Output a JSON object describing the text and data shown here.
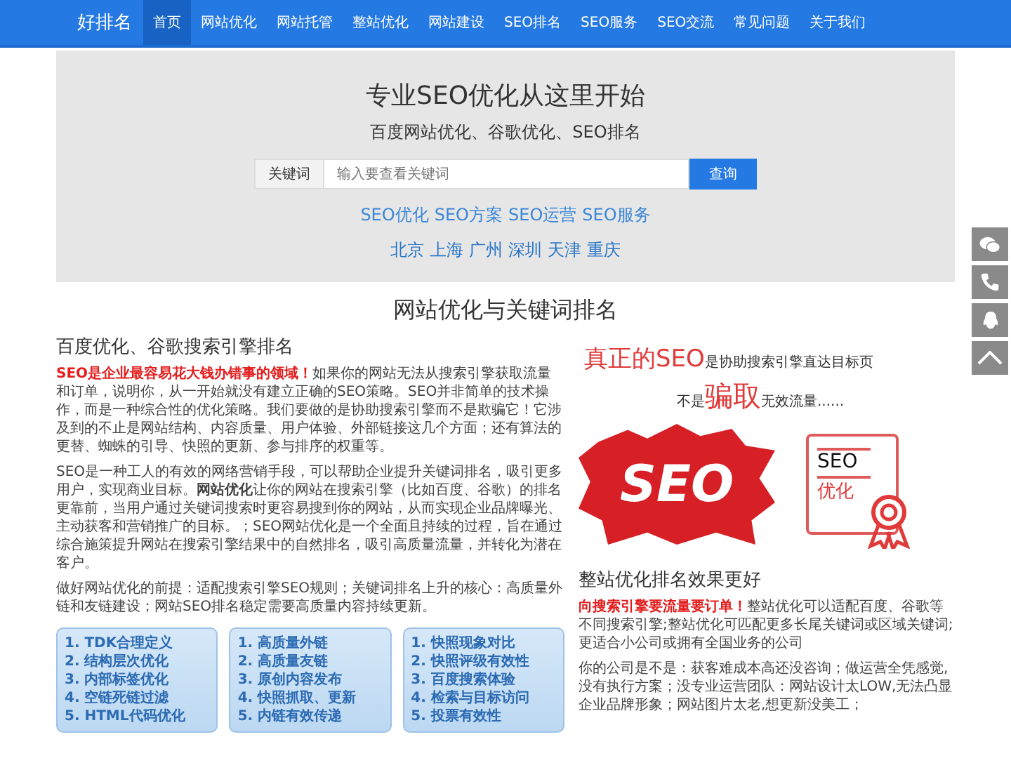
{
  "nav": {
    "brand": "好排名",
    "items": [
      {
        "label": "首页",
        "selected": true
      },
      {
        "label": "网站优化",
        "selected": false
      },
      {
        "label": "网站托管",
        "selected": false
      },
      {
        "label": "整站优化",
        "selected": false
      },
      {
        "label": "网站建设",
        "selected": false
      },
      {
        "label": "SEO排名",
        "selected": false
      },
      {
        "label": "SEO服务",
        "selected": false
      },
      {
        "label": "SEO交流",
        "selected": false
      },
      {
        "label": "常见问题",
        "selected": false
      },
      {
        "label": "关于我们",
        "selected": false
      }
    ]
  },
  "hero": {
    "title": "专业SEO优化从这里开始",
    "subtitle": "百度网站优化、谷歌优化、SEO排名",
    "search": {
      "label": "关键词",
      "placeholder": "输入要查看关键词",
      "button": "查询"
    },
    "tags": [
      "SEO优化",
      "SEO方案",
      "SEO运营",
      "SEO服务"
    ],
    "cities": [
      "北京",
      "上海",
      "广州",
      "深圳",
      "天津",
      "重庆"
    ]
  },
  "section_title": "网站优化与关键词排名",
  "left": {
    "heading": "百度优化、谷歌搜索引擎排名",
    "paragraphs": [
      {
        "lead": "SEO是企业最容易花大钱办错事的领域！",
        "text": "如果你的网站无法从搜索引擎获取流量和订单，说明你，从一开始就没有建立正确的SEO策略。SEO并非简单的技术操作，而是一种综合性的优化策略。我们要做的是协助搜索引擎而不是欺骗它！它涉及到的不止是网站结构、内容质量、用户体验、外部链接这几个方面；还有算法的更替、蜘蛛的引导、快照的更新、参与排序的权重等。"
      },
      {
        "text": "SEO是一种工人的有效的网络营销手段，可以帮助企业提升关键词排名，吸引更多用户，实现商业目标。**网站优化**让你的网站在搜索引擎（比如百度、谷歌）的排名更靠前，当用户通过关键词搜索时更容易搜到你的网站，从而实现企业品牌曝光、主动获客和营销推广的目标。；SEO网站优化是一个全面且持续的过程，旨在通过综合施策提升网站在搜索引擎结果中的自然排名，吸引高质量流量，并转化为潜在客户。"
      },
      {
        "text": "做好网站优化的前提：适配搜索引擎SEO规则；关键词排名上升的核心：高质量外链和友链建设；网站SEO排名稳定需要高质量内容持续更新。"
      }
    ],
    "feature_cards": [
      [
        "1. TDK合理定义",
        "2. 结构层次优化",
        "3. 内部标签优化",
        "4. 空链死链过滤",
        "5. HTML代码优化"
      ],
      [
        "1. 高质量外链",
        "2. 高质量友链",
        "3. 原创内容发布",
        "4. 快照抓取、更新",
        "5. 内链有效传递"
      ],
      [
        "1. 快照现象对比",
        "2. 快照评级有效性",
        "3. 百度搜索体验",
        "4. 检索与目标访问",
        "5. 投票有效性"
      ]
    ]
  },
  "right": {
    "promo": {
      "line1": {
        "emphasis": "真正的SEO",
        "rest": "是协助搜索引擎直达目标页"
      },
      "line2": {
        "before": "不是",
        "emphasis": "骗取",
        "after": "无效流量......"
      },
      "burst": "SEO",
      "certificate": [
        "SEO",
        "优化"
      ]
    },
    "heading": "整站优化排名效果更好",
    "paragraphs": [
      {
        "lead": "向搜索引擎要流量要订单！",
        "text": "整站优化可以适配百度、谷歌等不同搜索引擎;整站优化可匹配更多长尾关键词或区域关键词;更适合小公司或拥有全国业务的公司"
      },
      {
        "text": "你的公司是不是：获客难成本高还没咨询；做运营全凭感觉,没有执行方案；没专业运营团队：网站设计太LOW,无法凸显企业品牌形象；网站图片太老,想更新没美工；"
      }
    ]
  }
}
